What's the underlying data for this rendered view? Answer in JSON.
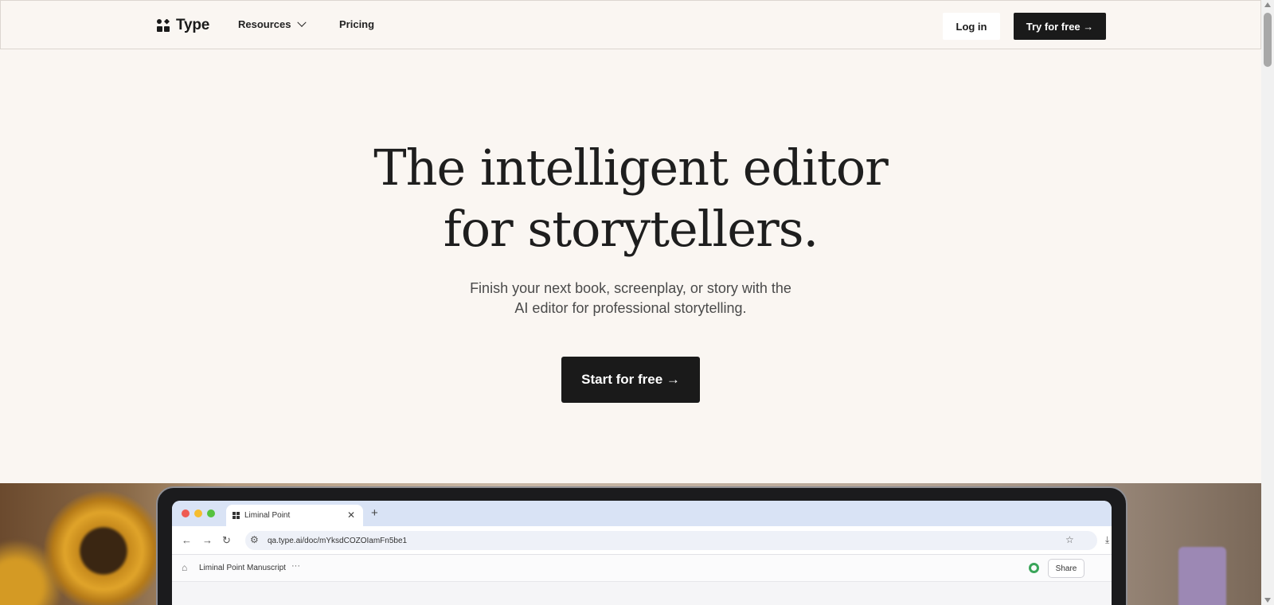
{
  "nav": {
    "logo_text": "Type",
    "resources_label": "Resources",
    "pricing_label": "Pricing",
    "login_label": "Log in",
    "try_label": "Try for free →"
  },
  "hero": {
    "headline_line1": "The intelligent editor",
    "headline_line2": "for storytellers.",
    "subhead_line1": "Finish your next book, screenplay, or story with the",
    "subhead_line2": "AI editor for professional storytelling.",
    "cta_label": "Start for free →"
  },
  "demo": {
    "tab_title": "Liminal Point",
    "url": "qa.type.ai/doc/mYksdCOZOIamFn5be1",
    "doc_title": "Liminal Point Manuscript",
    "share_label": "Share",
    "status_color": "#3aa55a"
  },
  "colors": {
    "background": "#faf6f2",
    "primary_button": "#1a1a1a"
  }
}
